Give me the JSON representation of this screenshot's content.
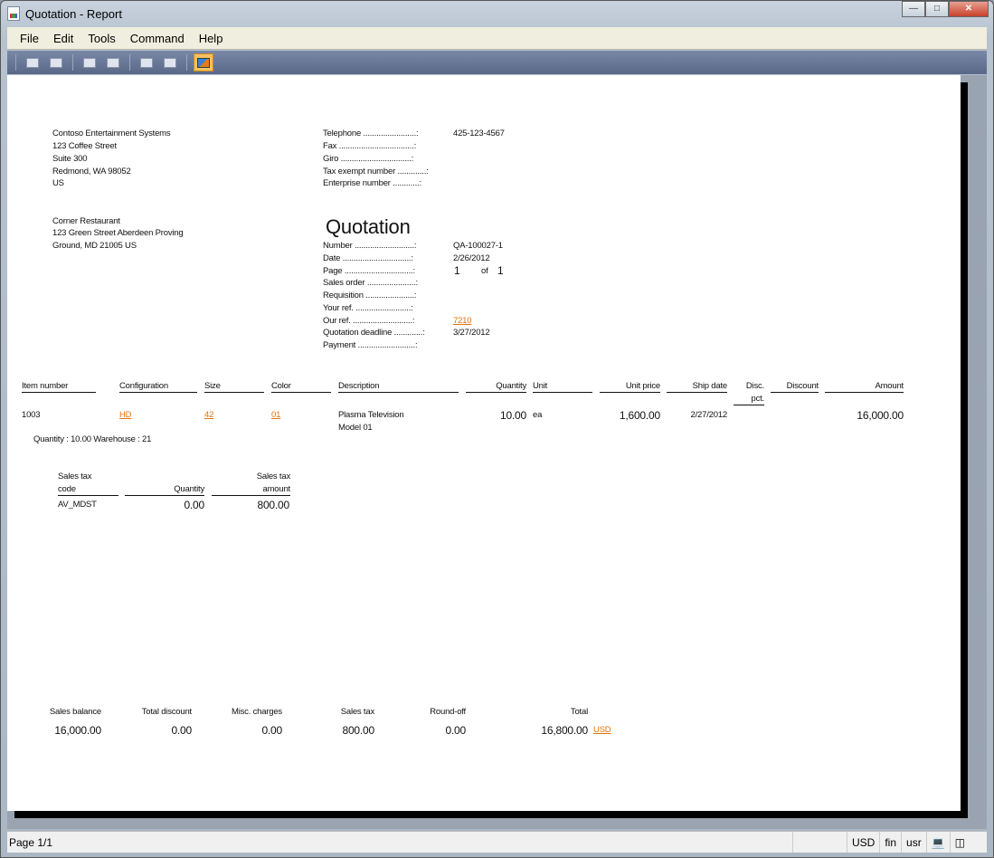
{
  "window": {
    "title": "Quotation - Report"
  },
  "menu": [
    "File",
    "Edit",
    "Tools",
    "Command",
    "Help"
  ],
  "company": {
    "name": "Contoso Entertainment Systems",
    "street": "123 Coffee Street",
    "suite": "Suite 300",
    "city": "Redmond, WA 98052",
    "country": "US"
  },
  "contact": [
    {
      "label": "Telephone ........................:",
      "value": "425-123-4567"
    },
    {
      "label": "Fax ..................................:",
      "value": ""
    },
    {
      "label": "Giro ................................:",
      "value": ""
    },
    {
      "label": "Tax exempt number .............:",
      "value": ""
    },
    {
      "label": "Enterprise number ............:",
      "value": ""
    }
  ],
  "customer": {
    "name": "Corner Restaurant",
    "line1": "123 Green Street Aberdeen Proving",
    "line2": "Ground, MD 21005 US"
  },
  "doc_title": "Quotation",
  "fields": [
    {
      "label": "Number ...........................:",
      "value": "QA-100027-1"
    },
    {
      "label": "Date ...............................:",
      "value": "2/26/2012"
    },
    {
      "label": "Sales order ......................:",
      "value": ""
    },
    {
      "label": "Requisition ......................:",
      "value": ""
    },
    {
      "label": "Your ref. .........................:",
      "value": ""
    },
    {
      "label": "Our ref. ...........................:",
      "value": "7210"
    },
    {
      "label": "Quotation deadline .............:",
      "value": "3/27/2012"
    },
    {
      "label": "Payment ..........................:",
      "value": ""
    }
  ],
  "page_field": {
    "label": "Page ...............................:",
    "page": "1",
    "of": "of",
    "total": "1"
  },
  "columns": {
    "item": "Item number",
    "config": "Configuration",
    "size": "Size",
    "color": "Color",
    "desc": "Description",
    "qty": "Quantity",
    "unit": "Unit",
    "price": "Unit price",
    "ship": "Ship date",
    "discpct1": "Disc.",
    "discpct2": "pct.",
    "discount": "Discount",
    "amount": "Amount"
  },
  "line": {
    "item": "1003",
    "config": "HD",
    "size": "42",
    "color": "01",
    "desc1": "Plasma Television",
    "desc2": "Model 01",
    "qty": "10.00",
    "unit": "ea",
    "price": "1,600.00",
    "ship": "2/27/2012",
    "amount": "16,000.00",
    "note": "Quantity : 10.00  Warehouse : 21"
  },
  "tax": {
    "h_code1": "Sales tax",
    "h_code2": "code",
    "h_qty": "Quantity",
    "h_amt1": "Sales tax",
    "h_amt2": "amount",
    "code": "AV_MDST",
    "qty": "0.00",
    "amt": "800.00"
  },
  "totals": {
    "l_bal": "Sales balance",
    "bal": "16,000.00",
    "l_disc": "Total discount",
    "disc": "0.00",
    "l_misc": "Misc. charges",
    "misc": "0.00",
    "l_tax": "Sales tax",
    "tax": "800.00",
    "l_round": "Round-off",
    "round": "0.00",
    "l_total": "Total",
    "total": "16,800.00",
    "currency": "USD"
  },
  "status": {
    "page": "Page 1/1",
    "currency": "USD",
    "company": "fin",
    "layer": "usr"
  }
}
